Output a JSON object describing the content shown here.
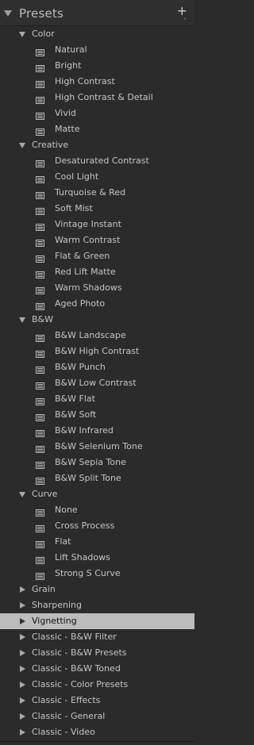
{
  "panel": {
    "title": "Presets",
    "add_button": "+",
    "add_button_sub": "-",
    "colors": {
      "background": "#2b2b2b",
      "text": "#c5c5c5",
      "selected_bg": "#bcbcbc",
      "selected_text": "#111111"
    }
  },
  "groups": [
    {
      "label": "Color",
      "expanded": true,
      "selected": false,
      "items": [
        "Natural",
        "Bright",
        "High Contrast",
        "High Contrast & Detail",
        "Vivid",
        "Matte"
      ]
    },
    {
      "label": "Creative",
      "expanded": true,
      "selected": false,
      "items": [
        "Desaturated Contrast",
        "Cool Light",
        "Turquoise & Red",
        "Soft Mist",
        "Vintage Instant",
        "Warm Contrast",
        "Flat & Green",
        "Red Lift Matte",
        "Warm Shadows",
        "Aged Photo"
      ]
    },
    {
      "label": "B&W",
      "expanded": true,
      "selected": false,
      "items": [
        "B&W Landscape",
        "B&W High Contrast",
        "B&W Punch",
        "B&W Low Contrast",
        "B&W Flat",
        "B&W Soft",
        "B&W Infrared",
        "B&W Selenium Tone",
        "B&W Sepia Tone",
        "B&W Split Tone"
      ]
    },
    {
      "label": "Curve",
      "expanded": true,
      "selected": false,
      "items": [
        "None",
        "Cross Process",
        "Flat",
        "Lift Shadows",
        "Strong S Curve"
      ]
    },
    {
      "label": "Grain",
      "expanded": false,
      "selected": false,
      "items": []
    },
    {
      "label": "Sharpening",
      "expanded": false,
      "selected": false,
      "items": []
    },
    {
      "label": "Vignetting",
      "expanded": false,
      "selected": true,
      "items": []
    },
    {
      "label": "Classic - B&W Filter",
      "expanded": false,
      "selected": false,
      "items": []
    },
    {
      "label": "Classic - B&W Presets",
      "expanded": false,
      "selected": false,
      "items": []
    },
    {
      "label": "Classic - B&W Toned",
      "expanded": false,
      "selected": false,
      "items": []
    },
    {
      "label": "Classic - Color Presets",
      "expanded": false,
      "selected": false,
      "items": []
    },
    {
      "label": "Classic - Effects",
      "expanded": false,
      "selected": false,
      "items": []
    },
    {
      "label": "Classic - General",
      "expanded": false,
      "selected": false,
      "items": []
    },
    {
      "label": "Classic - Video",
      "expanded": false,
      "selected": false,
      "items": []
    }
  ]
}
